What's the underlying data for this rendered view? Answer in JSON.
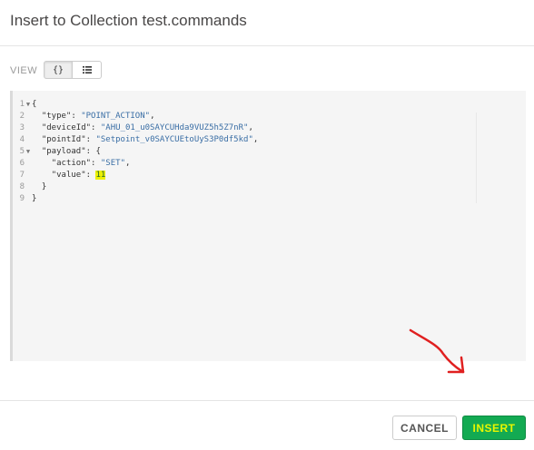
{
  "dialog": {
    "title": "Insert to Collection test.commands"
  },
  "view": {
    "label": "VIEW",
    "json_button": "{}",
    "list_icon": "list-icon"
  },
  "editor": {
    "lines": [
      {
        "n": "1",
        "fold": true
      },
      {
        "n": "2"
      },
      {
        "n": "3"
      },
      {
        "n": "4"
      },
      {
        "n": "5",
        "fold": true
      },
      {
        "n": "6"
      },
      {
        "n": "7"
      },
      {
        "n": "8"
      },
      {
        "n": "9"
      }
    ],
    "type_key": "\"type\"",
    "type_val": "\"POINT_ACTION\"",
    "deviceId_key": "\"deviceId\"",
    "deviceId_val": "\"AHU_01_u0SAYCUHda9VUZ5h5Z7nR\"",
    "pointId_key": "\"pointId\"",
    "pointId_val": "\"Setpoint_v0SAYCUEtoUyS3P0df5kd\"",
    "payload_key": "\"payload\"",
    "action_key": "\"action\"",
    "action_val": "\"SET\"",
    "value_key": "\"value\"",
    "value_val": "11"
  },
  "footer": {
    "cancel_label": "CANCEL",
    "insert_label": "INSERT"
  },
  "colors": {
    "insert_bg": "#13aa52",
    "highlight": "#ecf000",
    "annotation_arrow": "#e02020"
  }
}
